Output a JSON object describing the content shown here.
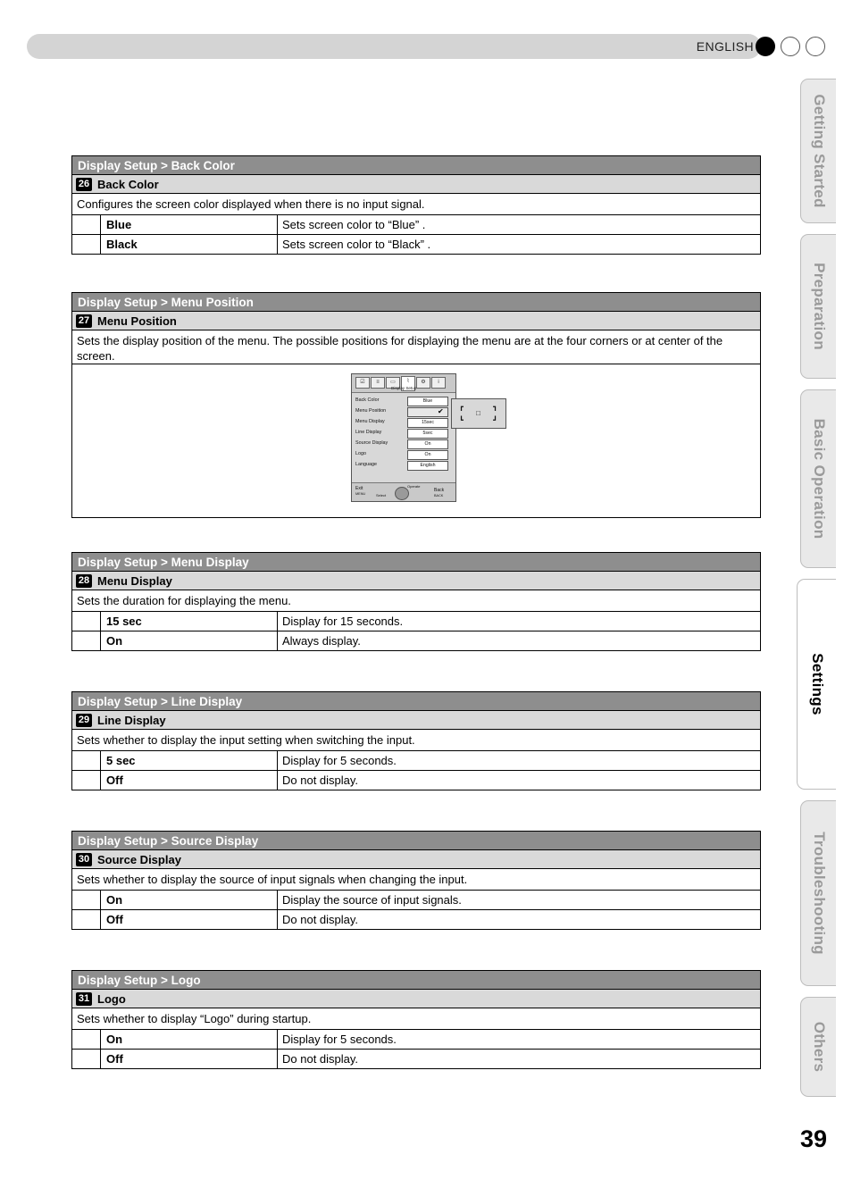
{
  "header": {
    "language": "ENGLISH",
    "dots": [
      "filled",
      "empty",
      "empty"
    ]
  },
  "side_tabs": [
    {
      "label": "Getting Started",
      "active": false
    },
    {
      "label": "Preparation",
      "active": false
    },
    {
      "label": "Basic Operation",
      "active": false
    },
    {
      "label": "Settings",
      "active": true
    },
    {
      "label": "Troubleshooting",
      "active": false
    },
    {
      "label": "Others",
      "active": false
    }
  ],
  "page_number": "39",
  "sections": [
    {
      "title": "Display Setup > Back Color",
      "number": "26",
      "item": "Back Color",
      "description": "Configures the screen color displayed when there is no input signal.",
      "options": [
        {
          "name": "Blue",
          "desc": "Sets screen color to “Blue” ."
        },
        {
          "name": "Black",
          "desc": "Sets screen color to “Black” ."
        }
      ]
    },
    {
      "title": "Display Setup > Menu Position",
      "number": "27",
      "item": "Menu Position",
      "description": "Sets the display position of the menu. The possible positions for displaying the menu are at the four corners or at center of the screen.",
      "options": []
    },
    {
      "title": "Display Setup > Menu Display",
      "number": "28",
      "item": "Menu Display",
      "description": "Sets the duration for displaying the menu.",
      "options": [
        {
          "name": "15 sec",
          "desc": "Display for 15 seconds."
        },
        {
          "name": "On",
          "desc": "Always display."
        }
      ]
    },
    {
      "title": "Display Setup > Line Display",
      "number": "29",
      "item": "Line Display",
      "description": "Sets whether to display the input setting when switching the input.",
      "options": [
        {
          "name": "5 sec",
          "desc": "Display for 5 seconds."
        },
        {
          "name": "Off",
          "desc": "Do not display."
        }
      ]
    },
    {
      "title": "Display Setup > Source Display",
      "number": "30",
      "item": "Source Display",
      "description": "Sets whether to display the source of input signals when changing the input.",
      "options": [
        {
          "name": "On",
          "desc": "Display the source of input signals."
        },
        {
          "name": "Off",
          "desc": "Do not display."
        }
      ]
    },
    {
      "title": "Display Setup > Logo",
      "number": "31",
      "item": "Logo",
      "description": "Sets whether to display “Logo” during startup.",
      "options": [
        {
          "name": "On",
          "desc": "Display for 5 seconds."
        },
        {
          "name": "Off",
          "desc": "Do not display."
        }
      ]
    }
  ],
  "osd": {
    "tab_caption": "Display Setup",
    "rows": [
      {
        "label": "Back Color",
        "value": "Blue",
        "highlight": false
      },
      {
        "label": "Menu Position",
        "value": "",
        "highlight": true
      },
      {
        "label": "Menu Display",
        "value": "15sec",
        "highlight": false
      },
      {
        "label": "Line Display",
        "value": "5sec",
        "highlight": false
      },
      {
        "label": "Source Display",
        "value": "On",
        "highlight": false
      },
      {
        "label": "Logo",
        "value": "On",
        "highlight": false
      },
      {
        "label": "Language",
        "value": "English",
        "highlight": false
      }
    ],
    "footer": {
      "exit": "Exit",
      "exit_sub": "MENU",
      "select": "Select",
      "operate": "Operate",
      "back": "Back",
      "back_sub": "BACK"
    },
    "position_popup": {
      "corners": [
        "┏",
        "┓",
        "┗",
        "┛"
      ],
      "center": "□",
      "check": "✔"
    }
  }
}
